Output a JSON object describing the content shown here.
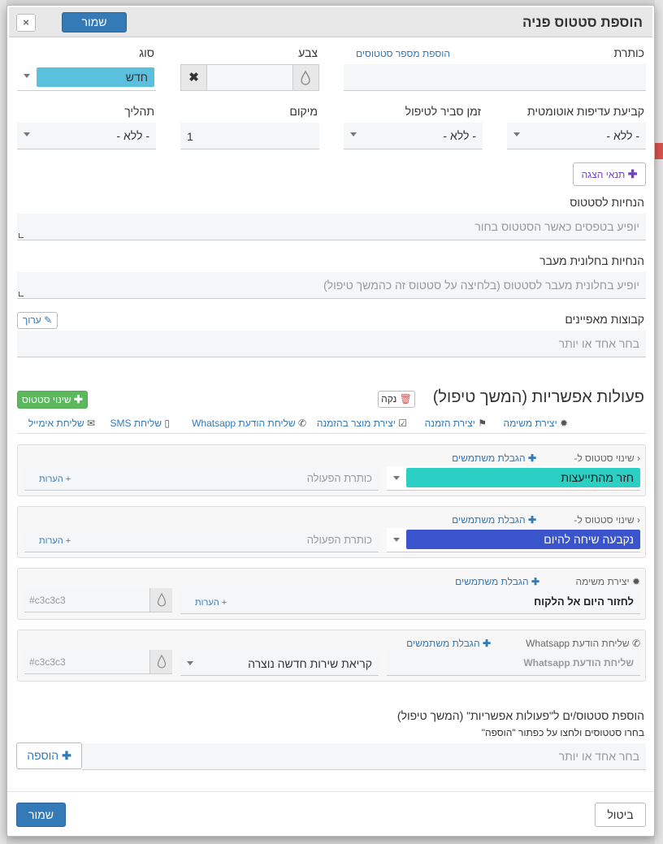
{
  "modal": {
    "title": "הוספת סטטוס פניה",
    "close_symbol": "×",
    "save_top_label": "שמור"
  },
  "fields": {
    "title_label": "כותרת",
    "add_multiple_link": "הוספת מספר סטטוסים",
    "color_label": "צבע",
    "type_label": "סוג",
    "type_value": "חדש",
    "auto_priority_label": "קביעת עדיפות אוטומטית",
    "auto_priority_value": "- ללא -",
    "handling_time_label": "זמן סביר לטיפול",
    "handling_time_value": "- ללא -",
    "position_label": "מיקום",
    "position_value": "1",
    "process_label": "תהליך",
    "process_value": "- ללא -",
    "display_conditions_button": "תנאי הצגה",
    "status_instructions_label": "הנחיות לסטטוס",
    "status_instructions_placeholder": "יופיע בטפסים כאשר הסטטוס בחור",
    "transition_instructions_label": "הנחיות בחלונית מעבר",
    "transition_instructions_placeholder": "יופיע בחלונית מעבר לסטטוס (בלחיצה על סטטוס זה כהמשך טיפול)",
    "groups_label": "קבוצות מאפיינים",
    "groups_edit_button": "ערוך",
    "groups_placeholder": "בחר אחד או יותר"
  },
  "actions": {
    "title": "פעולות אפשריות (המשך טיפול)",
    "clear_button": "נקה",
    "status_change_button": "שינוי סטטוס",
    "toolbar": [
      {
        "label": "יצירת משימה",
        "icon": "gear-icon"
      },
      {
        "label": "יצירת הזמנה",
        "icon": "flag-icon"
      },
      {
        "label": "יצירת מוצר בהזמנה",
        "icon": "checkbox-icon"
      },
      {
        "label": "שליחת הודעת Whatsapp",
        "icon": "whatsapp-icon"
      },
      {
        "label": "שליחת SMS",
        "icon": "mobile-icon"
      },
      {
        "label": "שליחת אימייל",
        "icon": "envelope-icon"
      }
    ],
    "cards": [
      {
        "type_label": "שינוי סטטוס ל-",
        "restrict_label": "הגבלת משתמשים",
        "status_value": "חזר מהתייעצות",
        "status_color": "#2ccfc4",
        "action_title_placeholder": "כותרת הפעולה",
        "notes_label": "+ הערות"
      },
      {
        "type_label": "שינוי סטטוס ל-",
        "restrict_label": "הגבלת משתמשים",
        "status_value": "נקבעה שיחה להיום",
        "status_color": "#3a55cc",
        "action_title_placeholder": "כותרת הפעולה",
        "notes_label": "+ הערות"
      },
      {
        "type_label": "יצירת משימה",
        "restrict_label": "הגבלת משתמשים",
        "task_value": "לחזור היום אל הלקוח",
        "notes_label": "+ הערות",
        "color_value": "#c3c3c3"
      },
      {
        "type_label": "שליחת הודעת Whatsapp",
        "restrict_label": "הגבלת משתמשים",
        "message_placeholder": "שליחת הודעת Whatsapp",
        "select_value": "קריאת שירות חדשה נוצרה",
        "color_value": "#c3c3c3"
      }
    ]
  },
  "add_statuses": {
    "title": "הוספת סטטוס/ים ל\"פעולות אפשריות\" (המשך טיפול)",
    "hint": "בחרו סטטוסים ולחצו על כפתור \"הוספה\"",
    "placeholder": "בחר אחד או יותר",
    "add_button": "הוספה"
  },
  "footer": {
    "save_label": "שמור",
    "cancel_label": "ביטול"
  },
  "colors": {
    "primary": "#337ab7",
    "success": "#5cb85c",
    "type_pill": "#5bc0de",
    "danger": "#d9534f"
  }
}
